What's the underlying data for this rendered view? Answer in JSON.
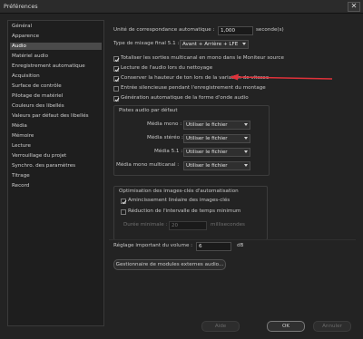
{
  "window": {
    "title": "Préférences",
    "close_glyph": "✕"
  },
  "sidebar": {
    "items": [
      {
        "label": "Général",
        "active": false
      },
      {
        "label": "Apparence",
        "active": false
      },
      {
        "label": "Audio",
        "active": true
      },
      {
        "label": "Matériel audio",
        "active": false
      },
      {
        "label": "Enregistrement automatique",
        "active": false
      },
      {
        "label": "Acquisition",
        "active": false
      },
      {
        "label": "Surface de contrôle",
        "active": false
      },
      {
        "label": "Pilotage de matériel",
        "active": false
      },
      {
        "label": "Couleurs des libellés",
        "active": false
      },
      {
        "label": "Valeurs par défaut des libellés",
        "active": false
      },
      {
        "label": "Média",
        "active": false
      },
      {
        "label": "Mémoire",
        "active": false
      },
      {
        "label": "Lecture",
        "active": false
      },
      {
        "label": "Verrouillage du projet",
        "active": false
      },
      {
        "label": "Synchro. des paramètres",
        "active": false
      },
      {
        "label": "Titrage",
        "active": false
      },
      {
        "label": "Record",
        "active": false
      }
    ]
  },
  "audio": {
    "auto_match_label": "Unité de correspondance automatique :",
    "auto_match_value": "1,000",
    "auto_match_unit": "seconde(s)",
    "mix_label": "Type de mixage final 5.1 :",
    "mix_value": "Avant + Arrière + LFE",
    "checkboxes": [
      {
        "label": "Totaliser les sorties multicanal en mono dans le Moniteur source",
        "checked": true
      },
      {
        "label": "Lecture de l'audio lors du nettoyage",
        "checked": true
      },
      {
        "label": "Conserver la hauteur de ton lors de la variation de vitesse",
        "checked": true
      },
      {
        "label": "Entrée silencieuse pendant l'enregistrement du montage",
        "checked": false
      },
      {
        "label": "Génération automatique de la forme d'onde audio",
        "checked": true
      }
    ],
    "default_tracks": {
      "title": "Pistes audio par défaut",
      "rows": [
        {
          "label": "Média mono :",
          "value": "Utiliser le fichier"
        },
        {
          "label": "Média stéréo :",
          "value": "Utiliser le fichier"
        },
        {
          "label": "Média 5.1 :",
          "value": "Utiliser le fichier"
        },
        {
          "label": "Média mono multicanal :",
          "value": "Utiliser le fichier"
        }
      ]
    },
    "keyframes": {
      "title": "Optimisation des images-clés d'automatisation",
      "linear_label": "Amincissement linéaire des images-clés",
      "linear_checked": true,
      "interval_label": "Réduction de l'intervalle de temps minimum",
      "interval_checked": false,
      "duration_label": "Durée minimale :",
      "duration_value": "20",
      "duration_unit": "millisecondes"
    },
    "volume_label": "Réglage important du volume :",
    "volume_value": "6",
    "volume_unit": "dB",
    "plugin_button": "Gestionnaire de modules externes audio..."
  },
  "footer": {
    "help": "Aide",
    "ok": "OK",
    "cancel": "Annuler"
  },
  "colors": {
    "annotation_arrow": "#e0323a"
  }
}
